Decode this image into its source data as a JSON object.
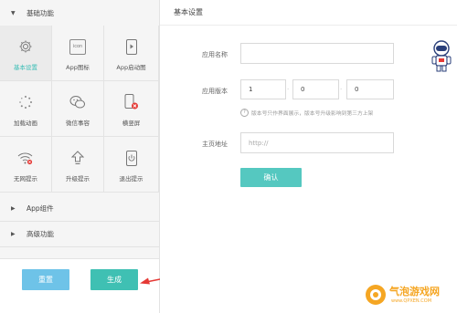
{
  "sidebar": {
    "section_basic": "基础功能",
    "section_components": "App组件",
    "section_advanced": "高级功能",
    "features": [
      {
        "label": "基本设置",
        "icon": "gear-icon",
        "active": true
      },
      {
        "label": "App图标",
        "icon": "app-icon",
        "icon_text": "icon"
      },
      {
        "label": "App启动图",
        "icon": "launch-image-icon"
      },
      {
        "label": "加载动画",
        "icon": "loading-spinner-icon"
      },
      {
        "label": "微信事容",
        "icon": "wechat-icon"
      },
      {
        "label": "横竖屏",
        "icon": "screen-orientation-icon"
      },
      {
        "label": "无网提示",
        "icon": "no-network-icon"
      },
      {
        "label": "升级提示",
        "icon": "upgrade-icon"
      },
      {
        "label": "退出提示",
        "icon": "exit-icon"
      }
    ],
    "reset_label": "重置",
    "generate_label": "生成"
  },
  "main": {
    "title": "基本设置",
    "app_name_label": "应用名称",
    "app_name_value": "",
    "version_label": "应用版本",
    "version": [
      "1",
      "0",
      "0"
    ],
    "version_hint": "版本号只作界面展示，版本号升级影响到第三方上架",
    "homepage_label": "主页地址",
    "homepage_placeholder": "http://",
    "confirm_label": "确认"
  },
  "watermark": {
    "brand": "气泡游戏网",
    "url": "www.QPXEN.COM"
  },
  "colors": {
    "accent": "#55c8c0",
    "reset_button": "#6ec3e8",
    "generate_button": "#3fc0b3",
    "active_text": "#39bdb5",
    "arrow": "#e53935"
  }
}
